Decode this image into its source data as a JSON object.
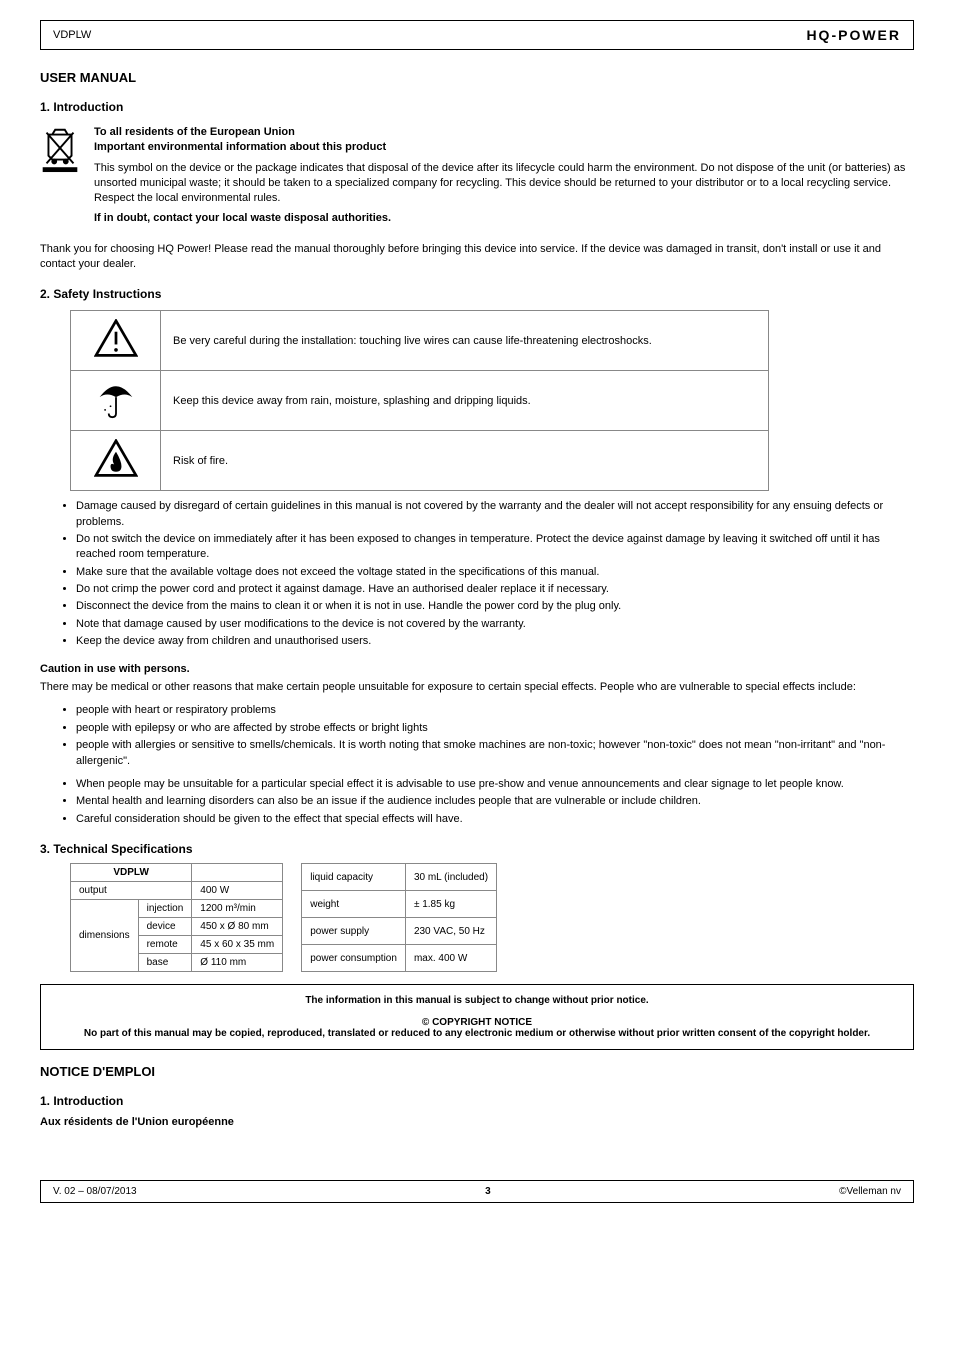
{
  "header": {
    "product": "VDPLW",
    "brand": "HQ-POWER"
  },
  "intro": {
    "title": "1. Introduction",
    "lead_en": "To all residents of the European Union",
    "lead_fr": "Important environmental information about this product",
    "weee_p1": "This symbol on the device or the package indicates that disposal of the device after its lifecycle could harm the environment. Do not dispose of the unit (or batteries) as unsorted municipal waste; it should be taken to a specialized company for recycling. This device should be returned to your distributor or to a local recycling service. Respect the local environmental rules.",
    "weee_p2": "If in doubt, contact your local waste disposal authorities.",
    "thanks": "Thank you for choosing HQ Power! Please read the manual thoroughly before bringing this device into service. If the device was damaged in transit, don't install or use it and contact your dealer."
  },
  "safety": {
    "title": "2. Safety Instructions",
    "symbols": [
      {
        "id": "warning",
        "text": "Be very careful during the installation: touching live wires can cause life-threatening electroshocks."
      },
      {
        "id": "umbrella",
        "text": "Keep this device away from rain, moisture, splashing and dripping liquids."
      },
      {
        "id": "fire",
        "text": "Risk of fire."
      }
    ],
    "bullets1": [
      "Damage caused by disregard of certain guidelines in this manual is not covered by the warranty and the dealer will not accept responsibility for any ensuing defects or problems.",
      "Do not switch the device on immediately after it has been exposed to changes in temperature. Protect the device against damage by leaving it switched off until it has reached room temperature.",
      "Make sure that the available voltage does not exceed the voltage stated in the specifications of this manual.",
      "Do not crimp the power cord and protect it against damage. Have an authorised dealer replace it if necessary.",
      "Disconnect the device from the mains to clean it or when it is not in use. Handle the power cord by the plug only.",
      "Note that damage caused by user modifications to the device is not covered by the warranty.",
      "Keep the device away from children and unauthorised users."
    ],
    "bullets2_heading": "Caution in use with persons.",
    "bullets2_intro": "There may be medical or other reasons that make certain people unsuitable for exposure to certain special effects. People who are vulnerable to special effects include:",
    "bullets2": [
      "people with heart or respiratory problems",
      "people with epilepsy or who are affected by strobe effects or bright lights",
      "people with allergies or sensitive to smells/chemicals. It is worth noting that smoke machines are non-toxic; however \"non-toxic\" does not mean \"non-irritant\" and \"non-allergenic\"."
    ],
    "bullets3": [
      "When people may be unsuitable for a particular special effect it is advisable to use pre-show and venue announcements and clear signage to let people know.",
      "Mental health and learning disorders can also be an issue if the audience includes people that are vulnerable or include children.",
      "Careful consideration should be given to the effect that special effects will have."
    ]
  },
  "tech": {
    "title": "3. Technical Specifications",
    "t1_header": "VDPLW",
    "t1_rows": [
      [
        "output",
        "",
        "400 W"
      ],
      [
        "",
        "injection",
        "1200 m³/min"
      ],
      [
        "dimensions",
        "device",
        "450 x Ø 80 mm"
      ],
      [
        "",
        "remote",
        "45 x 60 x 35 mm"
      ],
      [
        "",
        "base",
        "Ø 110 mm"
      ]
    ],
    "t2_rows": [
      [
        "liquid capacity",
        "30 mL (included)"
      ],
      [
        "weight",
        "± 1.85 kg"
      ],
      [
        "power supply",
        "230 VAC, 50 Hz"
      ],
      [
        "power consumption",
        "max. 400 W"
      ]
    ]
  },
  "notice": {
    "line1": "The information in this manual is subject to change without prior notice.",
    "line2a": "No part of this manual may be copied, reproduced, translated or reduced to any electronic medium or otherwise ",
    "line2b": "without prior written consent of the copyright holder.",
    "copyright": "© COPYRIGHT NOTICE"
  },
  "french": {
    "title": "NOTICE D'EMPLOI",
    "intro_title": "1. Introduction",
    "lead": "Aux résidents de l'Union européenne"
  },
  "footer": {
    "left": "V. 02 – 08/07/2013",
    "center": "3",
    "right": "©Velleman nv"
  }
}
